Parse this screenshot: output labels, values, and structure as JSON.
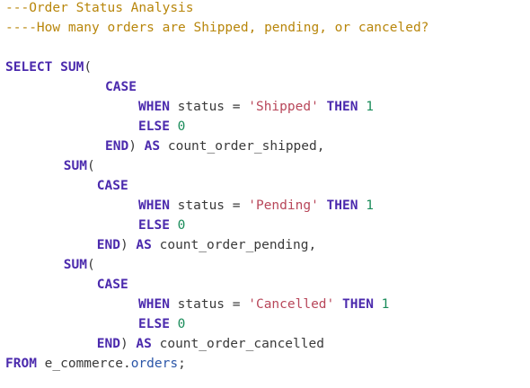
{
  "lines": [
    {
      "name": "comment-title",
      "indent": 0,
      "tokens": [
        {
          "t": "comment",
          "v": "---Order Status Analysis"
        }
      ]
    },
    {
      "name": "comment-question",
      "indent": 0,
      "tokens": [
        {
          "t": "comment",
          "v": "----How many orders are Shipped, pending, or canceled?"
        }
      ]
    },
    {
      "name": "blank-line",
      "indent": 0,
      "tokens": []
    },
    {
      "name": "select-sum-line",
      "indent": 0,
      "tokens": [
        {
          "t": "keyword",
          "v": "SELECT"
        },
        {
          "t": "ident",
          "v": " "
        },
        {
          "t": "keyword",
          "v": "SUM"
        },
        {
          "t": "punct",
          "v": "("
        }
      ]
    },
    {
      "name": "case-line",
      "indent": 12,
      "tokens": [
        {
          "t": "keyword",
          "v": "CASE"
        }
      ]
    },
    {
      "name": "when-shipped-line",
      "indent": 16,
      "tokens": [
        {
          "t": "keyword",
          "v": "WHEN"
        },
        {
          "t": "ident",
          "v": " status "
        },
        {
          "t": "op",
          "v": "="
        },
        {
          "t": "ident",
          "v": " "
        },
        {
          "t": "string",
          "v": "'Shipped'"
        },
        {
          "t": "ident",
          "v": " "
        },
        {
          "t": "keyword",
          "v": "THEN"
        },
        {
          "t": "ident",
          "v": " "
        },
        {
          "t": "number",
          "v": "1"
        }
      ]
    },
    {
      "name": "else-line",
      "indent": 16,
      "tokens": [
        {
          "t": "keyword",
          "v": "ELSE"
        },
        {
          "t": "ident",
          "v": " "
        },
        {
          "t": "number",
          "v": "0"
        }
      ]
    },
    {
      "name": "end-shipped-line",
      "indent": 12,
      "tokens": [
        {
          "t": "keyword",
          "v": "END"
        },
        {
          "t": "punct",
          "v": ")"
        },
        {
          "t": "ident",
          "v": " "
        },
        {
          "t": "keyword",
          "v": "AS"
        },
        {
          "t": "ident",
          "v": " count_order_shipped,"
        }
      ]
    },
    {
      "name": "sum-pending-line",
      "indent": 7,
      "tokens": [
        {
          "t": "keyword",
          "v": "SUM"
        },
        {
          "t": "punct",
          "v": "("
        }
      ]
    },
    {
      "name": "case-line",
      "indent": 11,
      "tokens": [
        {
          "t": "keyword",
          "v": "CASE"
        }
      ]
    },
    {
      "name": "when-pending-line",
      "indent": 16,
      "tokens": [
        {
          "t": "keyword",
          "v": "WHEN"
        },
        {
          "t": "ident",
          "v": " status "
        },
        {
          "t": "op",
          "v": "="
        },
        {
          "t": "ident",
          "v": " "
        },
        {
          "t": "string",
          "v": "'Pending'"
        },
        {
          "t": "ident",
          "v": " "
        },
        {
          "t": "keyword",
          "v": "THEN"
        },
        {
          "t": "ident",
          "v": " "
        },
        {
          "t": "number",
          "v": "1"
        }
      ]
    },
    {
      "name": "else-line",
      "indent": 16,
      "tokens": [
        {
          "t": "keyword",
          "v": "ELSE"
        },
        {
          "t": "ident",
          "v": " "
        },
        {
          "t": "number",
          "v": "0"
        }
      ]
    },
    {
      "name": "end-pending-line",
      "indent": 11,
      "tokens": [
        {
          "t": "keyword",
          "v": "END"
        },
        {
          "t": "punct",
          "v": ")"
        },
        {
          "t": "ident",
          "v": " "
        },
        {
          "t": "keyword",
          "v": "AS"
        },
        {
          "t": "ident",
          "v": " count_order_pending,"
        }
      ]
    },
    {
      "name": "sum-cancelled-line",
      "indent": 7,
      "tokens": [
        {
          "t": "keyword",
          "v": "SUM"
        },
        {
          "t": "punct",
          "v": "("
        }
      ]
    },
    {
      "name": "case-line",
      "indent": 11,
      "tokens": [
        {
          "t": "keyword",
          "v": "CASE"
        }
      ]
    },
    {
      "name": "when-cancelled-line",
      "indent": 16,
      "tokens": [
        {
          "t": "keyword",
          "v": "WHEN"
        },
        {
          "t": "ident",
          "v": " status "
        },
        {
          "t": "op",
          "v": "="
        },
        {
          "t": "ident",
          "v": " "
        },
        {
          "t": "string",
          "v": "'Cancelled'"
        },
        {
          "t": "ident",
          "v": " "
        },
        {
          "t": "keyword",
          "v": "THEN"
        },
        {
          "t": "ident",
          "v": " "
        },
        {
          "t": "number",
          "v": "1"
        }
      ]
    },
    {
      "name": "else-line",
      "indent": 16,
      "tokens": [
        {
          "t": "keyword",
          "v": "ELSE"
        },
        {
          "t": "ident",
          "v": " "
        },
        {
          "t": "number",
          "v": "0"
        }
      ]
    },
    {
      "name": "end-cancelled-line",
      "indent": 11,
      "tokens": [
        {
          "t": "keyword",
          "v": "END"
        },
        {
          "t": "punct",
          "v": ")"
        },
        {
          "t": "ident",
          "v": " "
        },
        {
          "t": "keyword",
          "v": "AS"
        },
        {
          "t": "ident",
          "v": " count_order_cancelled"
        }
      ]
    },
    {
      "name": "from-line",
      "indent": 0,
      "tokens": [
        {
          "t": "keyword",
          "v": "FROM"
        },
        {
          "t": "ident",
          "v": " e_commerce."
        },
        {
          "t": "field",
          "v": "orders"
        },
        {
          "t": "punct",
          "v": ";"
        }
      ]
    }
  ]
}
